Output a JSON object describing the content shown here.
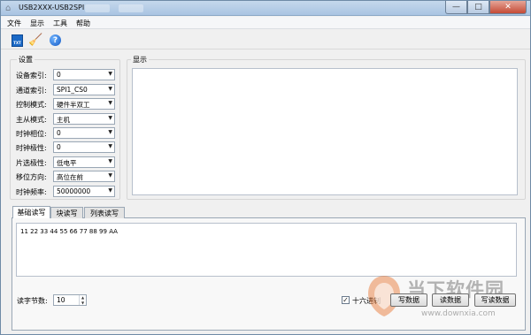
{
  "window": {
    "title": "USB2XXX-USB2SPI",
    "minimize_glyph": "—",
    "maximize_glyph": "□",
    "close_glyph": "✕"
  },
  "menu": [
    "文件",
    "显示",
    "工具",
    "帮助"
  ],
  "toolbar": {
    "icons": [
      "txt-file-icon",
      "broom-clear-icon",
      "help-icon"
    ],
    "txt_icon_text": "TXT",
    "help_glyph": "?"
  },
  "settings": {
    "label": "设置",
    "fields": [
      {
        "label": "设备索引:",
        "value": "0"
      },
      {
        "label": "通道索引:",
        "value": "SPI1_CS0"
      },
      {
        "label": "控制模式:",
        "value": "硬件半双工"
      },
      {
        "label": "主从模式:",
        "value": "主机"
      },
      {
        "label": "时钟相位:",
        "value": "0"
      },
      {
        "label": "时钟极性:",
        "value": "0"
      },
      {
        "label": "片选极性:",
        "value": "低电平"
      },
      {
        "label": "移位方向:",
        "value": "高位在前"
      },
      {
        "label": "时钟频率:",
        "value": "50000000"
      }
    ]
  },
  "display": {
    "label": "显示",
    "content": ""
  },
  "tabs": [
    {
      "label": "基础读写",
      "active": true
    },
    {
      "label": "块读写",
      "active": false
    },
    {
      "label": "列表读写",
      "active": false
    }
  ],
  "data_input": {
    "value": "11 22 33 44 55 66 77 88 99 AA"
  },
  "read_bytes": {
    "label": "读字节数:",
    "value": "10"
  },
  "hex": {
    "label": "十六进制",
    "checked": true,
    "check_glyph": "✓"
  },
  "buttons": {
    "write": "写数据",
    "read": "读数据",
    "write_read": "写读数据"
  },
  "watermark": {
    "title": "当下软件园",
    "url": "www.downxia.com"
  },
  "colors": {
    "titlebar": "#b4cce6",
    "close": "#c44a35",
    "accent": "#1b69c6"
  }
}
